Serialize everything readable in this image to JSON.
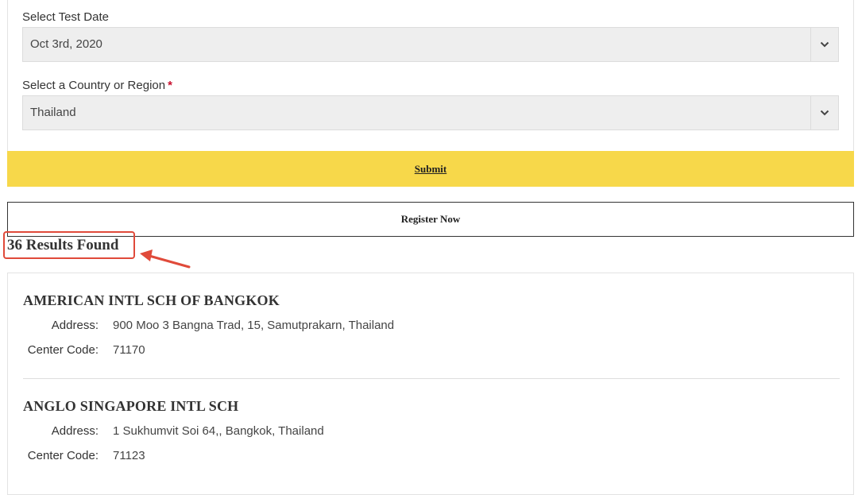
{
  "form": {
    "test_date_label": "Select Test Date",
    "test_date_value": "Oct 3rd, 2020",
    "country_label": "Select a Country or Region",
    "required_marker": "*",
    "country_value": "Thailand",
    "submit_label": "Submit",
    "register_label": "Register Now"
  },
  "results": {
    "count_text": "36 Results Found",
    "items": [
      {
        "name": "AMERICAN INTL SCH OF BANGKOK",
        "address_label": "Address:",
        "address": "900 Moo 3 Bangna Trad, 15, Samutprakarn, Thailand",
        "code_label": "Center Code:",
        "code": "71170"
      },
      {
        "name": "ANGLO SINGAPORE INTL SCH",
        "address_label": "Address:",
        "address": "1 Sukhumvit Soi 64,, Bangkok, Thailand",
        "code_label": "Center Code:",
        "code": "71123"
      }
    ]
  },
  "colors": {
    "submit_bg": "#f7d84a",
    "annotation": "#e04a3a",
    "required": "#c8102e"
  },
  "icons": {
    "dropdown": "chevron-down-icon",
    "annotation": "arrow-icon"
  }
}
